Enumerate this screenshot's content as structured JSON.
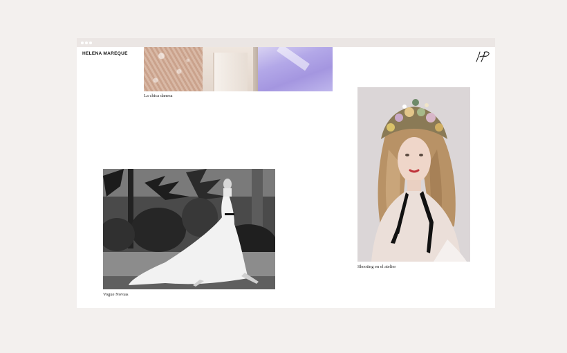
{
  "brand": {
    "name": "HELENA MAREQUE",
    "monogram": "HP"
  },
  "gallery": [
    {
      "caption": "La chica danesa"
    },
    {
      "caption": "Vogue Novias"
    },
    {
      "caption": "Shooting en el atelier"
    }
  ],
  "colors": {
    "page_bg": "#f3f0ee",
    "titlebar": "#ebe6e4",
    "content_bg": "#ffffff",
    "text": "#111111"
  }
}
